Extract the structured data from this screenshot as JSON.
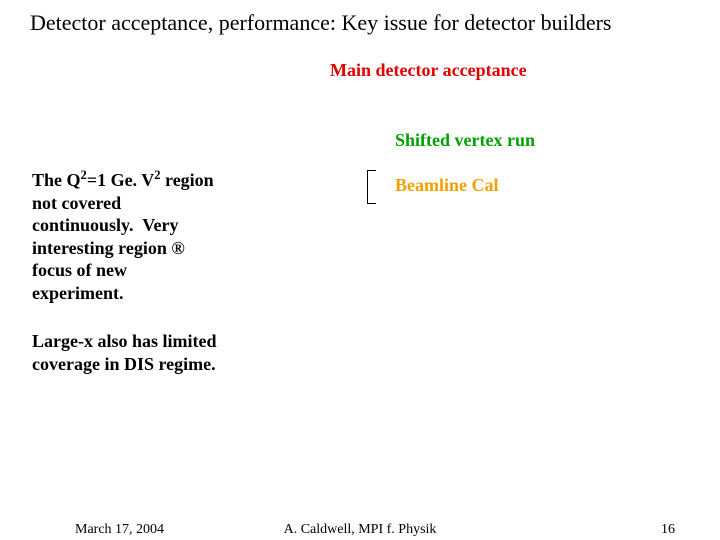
{
  "title": "Detector acceptance, performance: Key issue for detector builders",
  "labels": {
    "main_acceptance": "Main detector acceptance",
    "shifted_vertex": "Shifted vertex run",
    "beamline_cal": "Beamline Cal"
  },
  "paragraphs": {
    "q2_pre": "The Q",
    "q2_sup1": "2",
    "q2_mid": "=1 Ge. V",
    "q2_sup2": "2",
    "q2_post": " region not covered continuously.  Very interesting region ® focus of new experiment.",
    "largex": "Large-x also has limited coverage in DIS regime."
  },
  "footer": {
    "date": "March 17, 2004",
    "center": "A. Caldwell, MPI f. Physik",
    "page": "16"
  }
}
